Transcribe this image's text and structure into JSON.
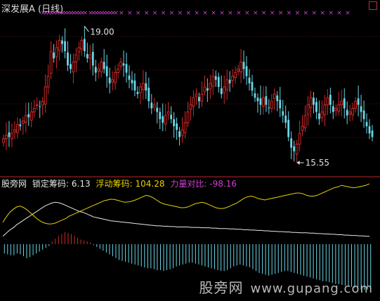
{
  "header": {
    "title": "深发展A (日线)"
  },
  "indicator": {
    "name": "股旁网",
    "lock_label": "锁定筹码:",
    "lock_value": "6.13",
    "float_label": "浮动筹码:",
    "float_value": "104.28",
    "power_label": "力量对比:",
    "power_value": "-98.16"
  },
  "watermark": {
    "cn": "股旁网",
    "url": "www.gupang.com"
  },
  "colors": {
    "up": "#d02828",
    "down": "#68d8e8",
    "line_white": "#e8e8e8",
    "line_yellow": "#e6d200",
    "marker": "#d040d0"
  },
  "chart_data": [
    {
      "type": "candlestick",
      "title": "深发展A (日线)",
      "annotations": [
        {
          "text": "19.00",
          "at": "high"
        },
        {
          "text": "15.55",
          "at": "low"
        }
      ],
      "price_range": [
        15.2,
        19.4
      ],
      "close": [
        15.95,
        16.05,
        16.0,
        16.1,
        16.2,
        16.35,
        16.3,
        16.45,
        16.6,
        16.55,
        16.7,
        16.8,
        16.9,
        16.85,
        17.0,
        17.4,
        17.7,
        18.4,
        18.2,
        18.5,
        18.7,
        18.6,
        18.4,
        18.0,
        17.9,
        18.1,
        18.3,
        18.5,
        18.7,
        18.4,
        18.2,
        18.3,
        18.0,
        17.8,
        17.9,
        18.1,
        17.9,
        17.7,
        17.5,
        17.6,
        17.8,
        17.9,
        18.1,
        18.0,
        17.8,
        17.6,
        17.5,
        17.3,
        17.2,
        17.4,
        17.5,
        17.3,
        17.0,
        16.8,
        16.9,
        16.7,
        16.5,
        16.4,
        16.6,
        16.7,
        16.5,
        16.3,
        16.2,
        16.0,
        16.2,
        16.4,
        16.7,
        16.9,
        17.1,
        17.2,
        17.0,
        17.2,
        17.4,
        17.3,
        17.5,
        17.7,
        17.6,
        17.4,
        17.2,
        17.4,
        17.6,
        17.5,
        17.7,
        17.8,
        17.9,
        18.1,
        17.9,
        17.7,
        17.5,
        17.3,
        17.1,
        17.0,
        16.9,
        17.1,
        16.9,
        16.8,
        17.0,
        17.2,
        17.0,
        16.8,
        16.6,
        16.4,
        16.0,
        15.7,
        15.6,
        15.8,
        16.1,
        16.3,
        16.6,
        16.9,
        17.1,
        16.9,
        16.7,
        16.5,
        16.7,
        16.9,
        17.1,
        16.9,
        16.7,
        16.8,
        16.9,
        17.0,
        16.8,
        16.6,
        16.7,
        16.8,
        17.0,
        16.9,
        16.7,
        16.5,
        16.3,
        16.1,
        16.0
      ],
      "sell_signals": [
        14,
        15,
        16,
        17,
        18,
        19,
        20,
        21,
        22,
        23,
        24,
        25,
        26,
        27,
        28,
        29,
        31,
        32,
        33,
        34,
        35,
        36,
        37,
        38,
        39,
        40,
        41,
        42,
        43,
        44,
        45,
        46,
        47,
        48,
        49,
        50,
        51,
        52,
        53,
        54,
        55,
        56,
        57,
        58,
        59,
        60,
        61,
        62,
        63,
        64,
        65,
        66,
        67,
        68,
        69,
        70,
        71,
        72,
        73,
        74,
        75,
        76,
        77,
        78,
        79,
        80,
        81,
        82,
        83,
        84,
        85,
        86,
        87,
        88,
        89,
        90,
        91,
        92,
        93,
        94,
        95,
        96,
        97,
        98,
        99,
        100,
        101,
        102,
        103,
        104,
        105,
        106,
        107,
        108,
        109,
        110,
        111,
        112,
        113,
        114,
        115,
        116,
        117,
        118,
        119,
        120,
        121,
        122,
        123
      ]
    },
    {
      "type": "line",
      "title": "股旁网",
      "series": [
        {
          "name": "锁定筹码",
          "values": [
            6,
            14,
            22,
            28,
            36,
            42,
            48,
            54,
            60,
            66,
            72,
            78,
            84,
            88,
            92,
            94,
            93,
            90,
            86,
            82,
            78,
            74,
            70,
            68,
            64,
            60,
            56,
            54,
            52,
            50,
            48,
            46,
            45,
            44,
            43,
            42,
            41,
            40,
            39,
            38,
            37,
            36,
            35,
            34,
            33,
            33,
            32,
            32,
            31,
            31,
            30,
            30,
            30,
            30,
            29,
            29,
            29,
            28,
            28,
            28,
            27,
            27,
            26,
            26,
            26,
            25,
            25,
            24,
            24,
            23,
            23,
            22,
            22,
            21,
            21,
            20,
            20,
            19,
            19,
            18,
            18,
            17,
            17,
            16,
            16,
            15,
            15,
            15,
            14,
            14,
            13,
            13,
            12,
            12,
            11,
            11,
            10,
            10,
            9,
            9,
            8,
            8,
            7,
            7,
            6,
            6
          ]
        },
        {
          "name": "浮动筹码",
          "values": [
            42,
            56,
            68,
            76,
            82,
            84,
            80,
            74,
            66,
            58,
            50,
            44,
            40,
            38,
            38,
            40,
            44,
            48,
            52,
            58,
            62,
            66,
            70,
            74,
            78,
            82,
            86,
            90,
            94,
            98,
            100,
            102,
            101,
            99,
            96,
            94,
            95,
            97,
            100,
            104,
            108,
            112,
            110,
            106,
            100,
            94,
            90,
            88,
            86,
            84,
            82,
            80,
            80,
            82,
            86,
            90,
            92,
            94,
            92,
            88,
            84,
            80,
            78,
            78,
            80,
            84,
            88,
            92,
            98,
            104,
            108,
            110,
            108,
            104,
            102,
            100,
            102,
            104,
            106,
            108,
            110,
            112,
            114,
            116,
            118,
            118,
            116,
            112,
            110,
            110,
            112,
            116,
            120,
            124,
            128,
            132,
            134,
            138,
            136,
            134,
            132,
            132,
            134,
            136,
            138,
            142
          ]
        }
      ]
    },
    {
      "type": "bar",
      "title": "力量对比",
      "values": [
        -20,
        -22,
        -24,
        -24,
        -20,
        -22,
        -26,
        -30,
        -28,
        -24,
        -20,
        -16,
        -12,
        -8,
        -4,
        6,
        12,
        18,
        22,
        26,
        24,
        22,
        18,
        14,
        10,
        8,
        6,
        4,
        -2,
        -6,
        -10,
        -14,
        -18,
        -22,
        -26,
        -30,
        -34,
        -36,
        -38,
        -40,
        -42,
        -44,
        -46,
        -48,
        -50,
        -52,
        -52,
        -54,
        -56,
        -56,
        -58,
        -56,
        -54,
        -52,
        -48,
        -46,
        -44,
        -42,
        -40,
        -40,
        -42,
        -44,
        -46,
        -48,
        -50,
        -52,
        -54,
        -56,
        -58,
        -58,
        -56,
        -52,
        -48,
        -46,
        -44,
        -46,
        -48,
        -50,
        -54,
        -58,
        -62,
        -64,
        -66,
        -68,
        -66,
        -64,
        -62,
        -60,
        -58,
        -58,
        -60,
        -62,
        -64,
        -66,
        -68,
        -70,
        -72,
        -74,
        -76,
        -78,
        -80,
        -80,
        -82,
        -84,
        -86,
        -86,
        -88,
        -90,
        -92,
        -92,
        -94,
        -96,
        -98,
        -98,
        -98,
        -98
      ]
    }
  ]
}
